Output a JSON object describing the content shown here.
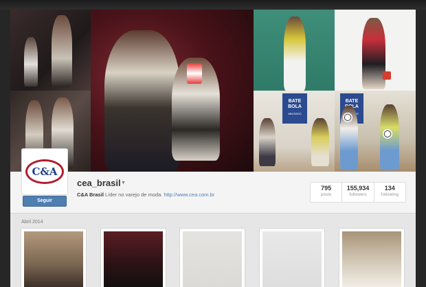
{
  "profile": {
    "username": "cea_brasil",
    "bio_name": "C&A Brasil",
    "bio_text": " Líder no varejo de moda. ",
    "bio_link": "http://www.cea.com.br",
    "follow_label": "Seguir",
    "logo_text": "C&A"
  },
  "stats": [
    {
      "value": "795",
      "label": "posts"
    },
    {
      "value": "155,934",
      "label": "followers"
    },
    {
      "value": "134",
      "label": "following"
    }
  ],
  "cover": {
    "bate_bola_title": "BATE BOLA",
    "bate_bola_sub": "ABUSADO"
  },
  "feed": {
    "date_label": "Abril 2014"
  },
  "colors": {
    "follow_button": "#4f7eb1",
    "logo_red": "#b01c2e",
    "logo_blue": "#1f3e93",
    "link": "#4f7eb1"
  }
}
